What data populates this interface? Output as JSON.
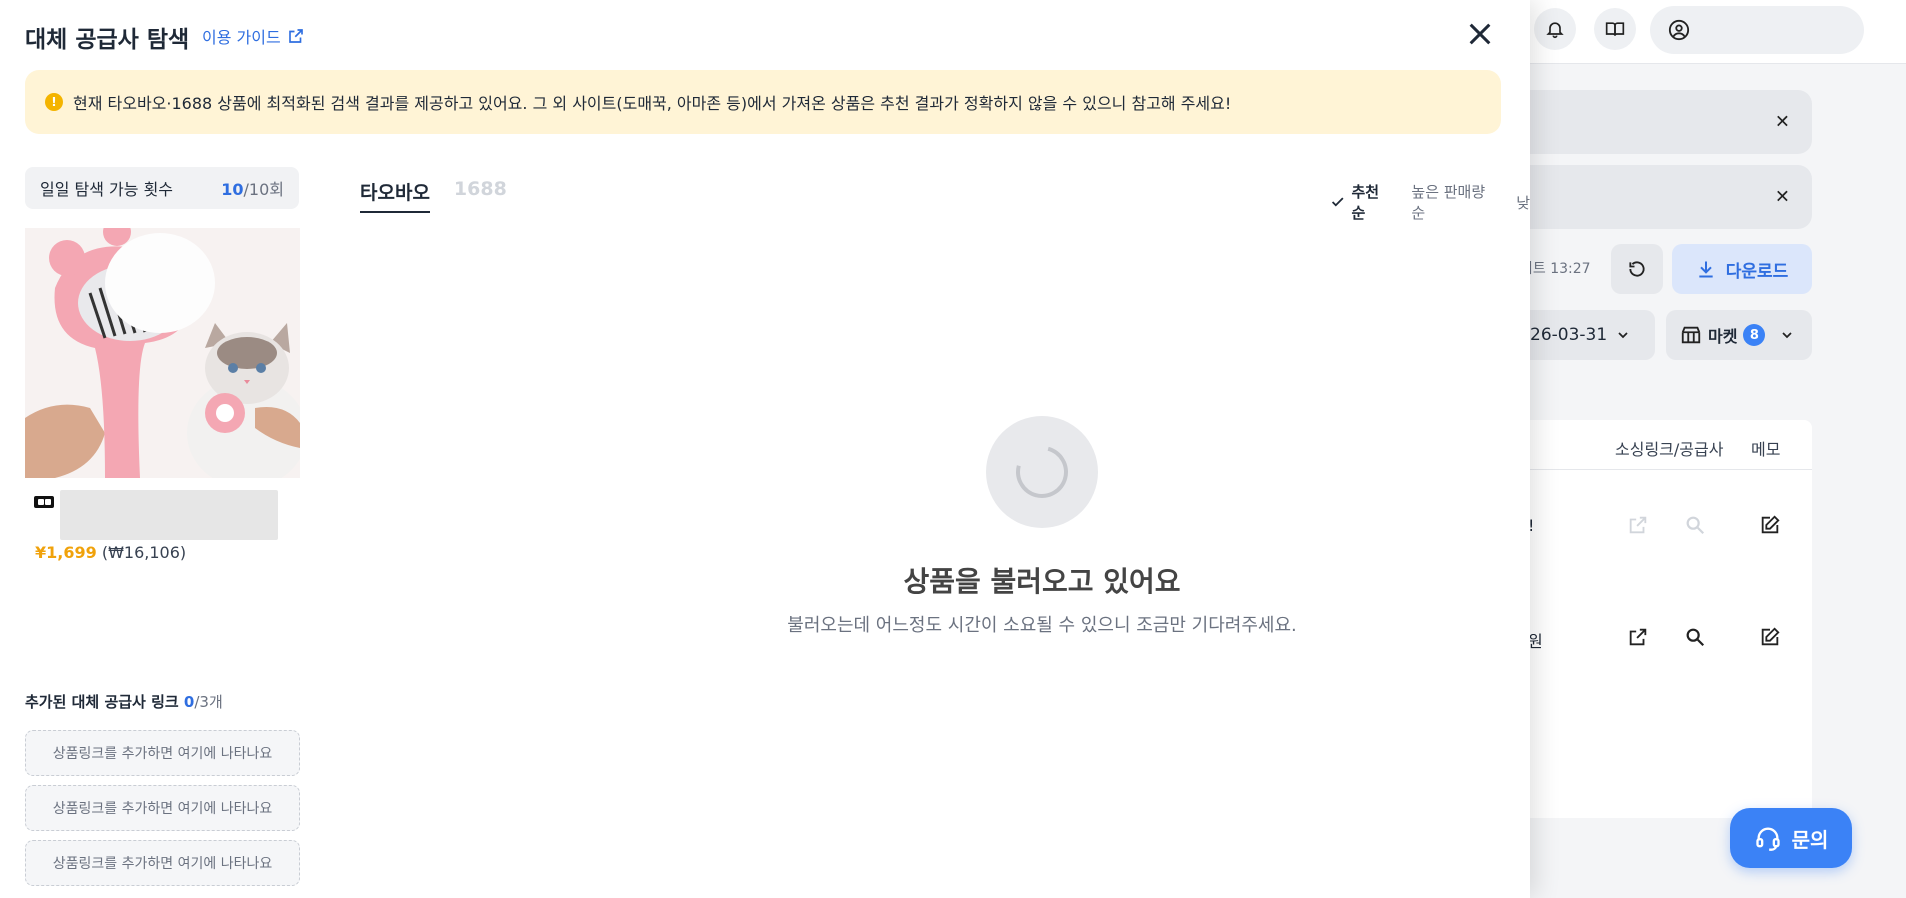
{
  "modal": {
    "title": "대체 공급사 탐색",
    "guide_link": "이용 가이드",
    "notice": "현재 타오바오·1688 상품에 최적화된 검색 결과를 제공하고 있어요. 그 외 사이트(도매꾹, 아마존 등)에서 가져온 상품은 추천 결과가 정확하지 않을 수 있으니 참고해 주세요!",
    "quota": {
      "label": "일일 탐색 가능 횟수",
      "current": "10",
      "total": "/10회"
    },
    "product": {
      "price_cny": "¥1,699",
      "price_krw": "(₩16,106)"
    },
    "added_links": {
      "title": "추가된 대체 공급사 링크",
      "count": "0",
      "max": "/3개",
      "slots": [
        "상품링크를 추가하면 여기에 나타나요",
        "상품링크를 추가하면 여기에 나타나요",
        "상품링크를 추가하면 여기에 나타나요"
      ]
    },
    "tabs": [
      {
        "label": "타오바오",
        "active": true
      },
      {
        "label": "1688",
        "active": false
      }
    ],
    "sort": {
      "selected": "추천순",
      "other": "높은 판매량순",
      "cut": "낮"
    },
    "loading": {
      "title": "상품을 불러오고 있어요",
      "subtitle": "불러오는데 어느정도 시간이 소요될 수 있으니 조금만 기다려주세요."
    }
  },
  "background": {
    "updated": "이트 13:27",
    "download_label": "다운로드",
    "date_value": "26-03-31",
    "market_label": "마켓",
    "market_count": "8",
    "table": {
      "headers": [
        "소싱링크/공급사",
        "메모"
      ],
      "row1_text": "!",
      "row2_text": "원"
    },
    "fab_label": "문의"
  },
  "colors": {
    "accent": "#2f6ee0",
    "warning_bg": "#fff4d6",
    "price": "#f0a20b",
    "fab": "#3b82f6"
  }
}
